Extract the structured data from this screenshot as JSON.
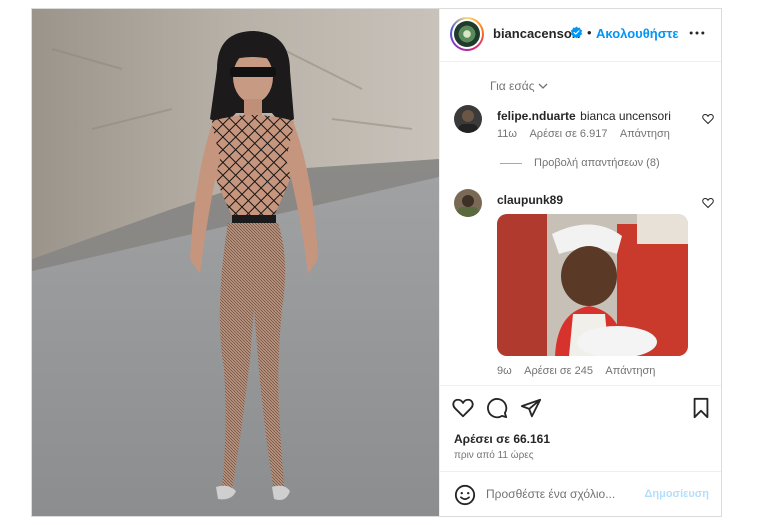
{
  "header": {
    "username": "biancacensori",
    "separator": "•",
    "follow_label": "Ακολουθήστε"
  },
  "comments_section": {
    "for_you_label": "Για εσάς",
    "comments": [
      {
        "username": "felipe.nduarte",
        "text": "bianca uncensori",
        "age": "11ω",
        "likes": "Αρέσει σε 6.917",
        "reply_label": "Απάντηση",
        "view_replies": "Προβολή απαντήσεων (8)"
      },
      {
        "username": "claupunk89",
        "text": "",
        "age": "9ω",
        "likes": "Αρέσει σε 245",
        "reply_label": "Απάντηση"
      }
    ]
  },
  "footer": {
    "likes": "Αρέσει σε 66.161",
    "posted": "πριν από 11 ώρες",
    "comment_placeholder": "Προσθέστε ένα σχόλιο...",
    "post_label": "Δημοσίευση"
  },
  "colors": {
    "accent": "#0095f6",
    "text": "#262626",
    "muted": "#737373"
  }
}
